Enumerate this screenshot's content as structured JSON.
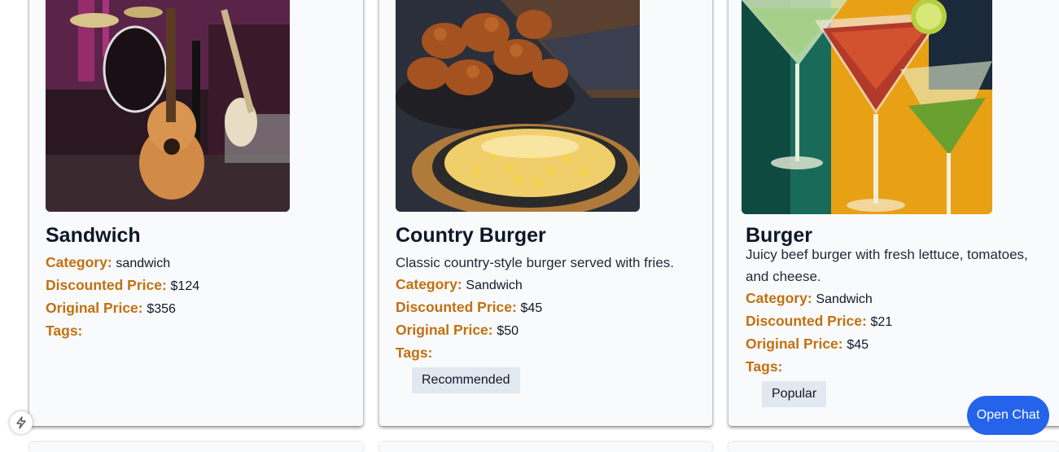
{
  "cards": [
    {
      "title": "Sandwich",
      "description": "",
      "category_label": "Category:",
      "category": "sandwich",
      "discounted_label": "Discounted Price:",
      "discounted": "$124",
      "original_label": "Original Price:",
      "original": "$356",
      "tags_label": "Tags:",
      "tags": [],
      "image_icon": "music-instruments-photo"
    },
    {
      "title": "Country Burger",
      "description": "Classic country-style burger served with fries.",
      "category_label": "Category:",
      "category": "Sandwich",
      "discounted_label": "Discounted Price:",
      "discounted": "$45",
      "original_label": "Original Price:",
      "original": "$50",
      "tags_label": "Tags:",
      "tags": [
        "Recommended"
      ],
      "image_icon": "fried-chicken-photo"
    },
    {
      "title": "Burger",
      "description": "Juicy beef burger with fresh lettuce, tomatoes, and cheese.",
      "category_label": "Category:",
      "category": "Sandwich",
      "discounted_label": "Discounted Price:",
      "discounted": "$21",
      "original_label": "Original Price:",
      "original": "$45",
      "tags_label": "Tags:",
      "tags": [
        "Popular"
      ],
      "image_icon": "cocktails-photo"
    }
  ],
  "chat": {
    "button_label": "Open Chat"
  },
  "colors": {
    "label": "#c2700e",
    "chat_button": "#2563eb",
    "tag_bg": "#e2e8f0"
  }
}
